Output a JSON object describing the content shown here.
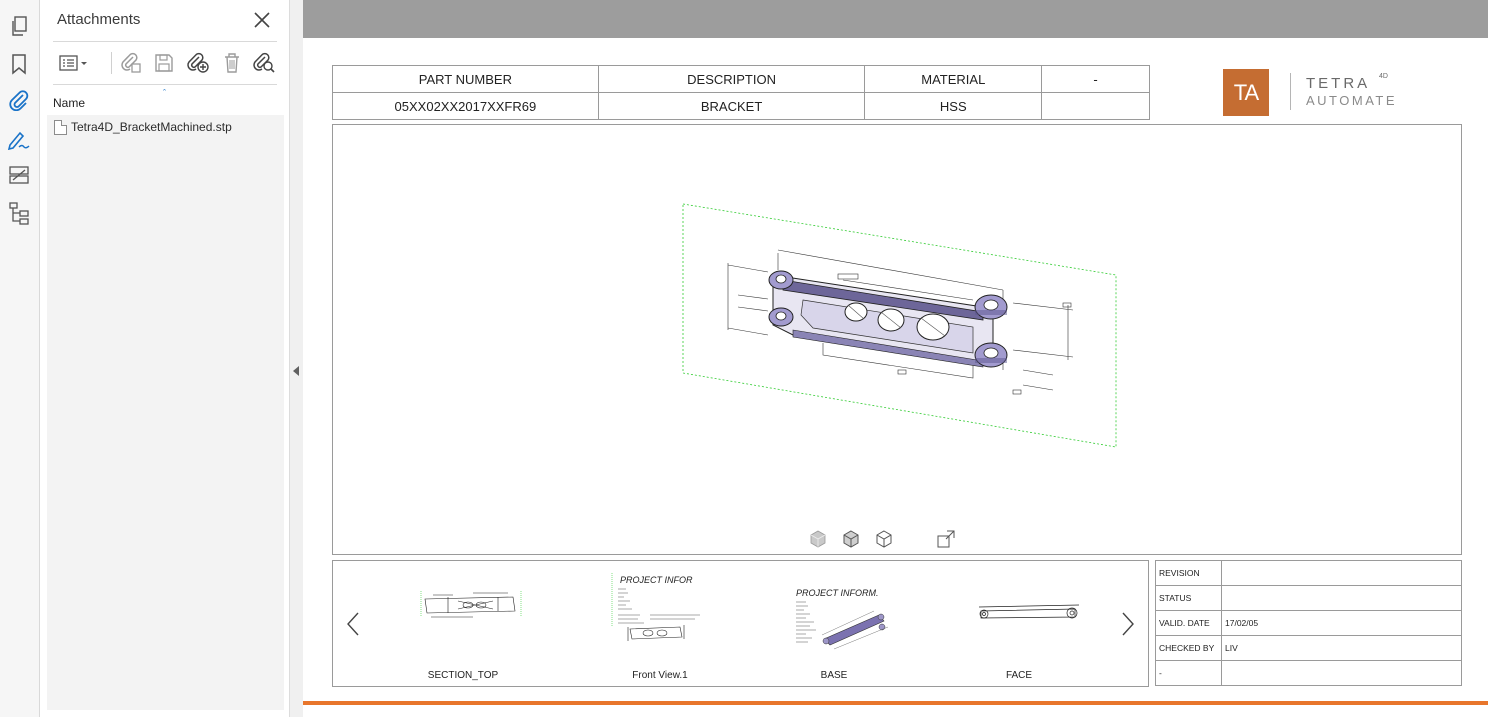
{
  "sidebar_rail": {
    "icons": [
      "pages-icon",
      "bookmark-icon",
      "attachment-icon",
      "sign-icon",
      "compare-icon",
      "tree-icon"
    ],
    "active_color": "#1a73c8"
  },
  "attachments_panel": {
    "title": "Attachments",
    "column_header": "Name",
    "sort_indicator": "ˆ",
    "files": [
      {
        "name": "Tetra4D_BracketMachined.stp"
      }
    ]
  },
  "part_table": {
    "headers": [
      "PART NUMBER",
      "DESCRIPTION",
      "MATERIAL",
      "-"
    ],
    "values": [
      "05XX02XX2017XXFR69",
      "BRACKET",
      "HSS",
      ""
    ]
  },
  "logo": {
    "mark": "TA",
    "name": "TETRA",
    "superscript": "4D",
    "tagline": "AUTOMATE",
    "brand_color": "#c56d32"
  },
  "views": {
    "thumbnails": [
      {
        "label": "SECTION_TOP"
      },
      {
        "label": "Front View.1"
      },
      {
        "label": "BASE"
      },
      {
        "label": "FACE"
      }
    ],
    "front_view_text": "PROJECT  INFOR",
    "base_text": "PROJECT  INFORM."
  },
  "revision_table": {
    "rows": [
      {
        "key": "REVISION",
        "value": ""
      },
      {
        "key": "STATUS",
        "value": ""
      },
      {
        "key": "VALID. DATE",
        "value": "17/02/05"
      },
      {
        "key": "CHECKED BY",
        "value": "LIV"
      },
      {
        "key": "-",
        "value": ""
      }
    ]
  },
  "colors": {
    "topbar": "#9d9d9d",
    "accent_line": "#e8762c",
    "model_plane": "#33cc33",
    "model_body": "#9d96c8"
  }
}
